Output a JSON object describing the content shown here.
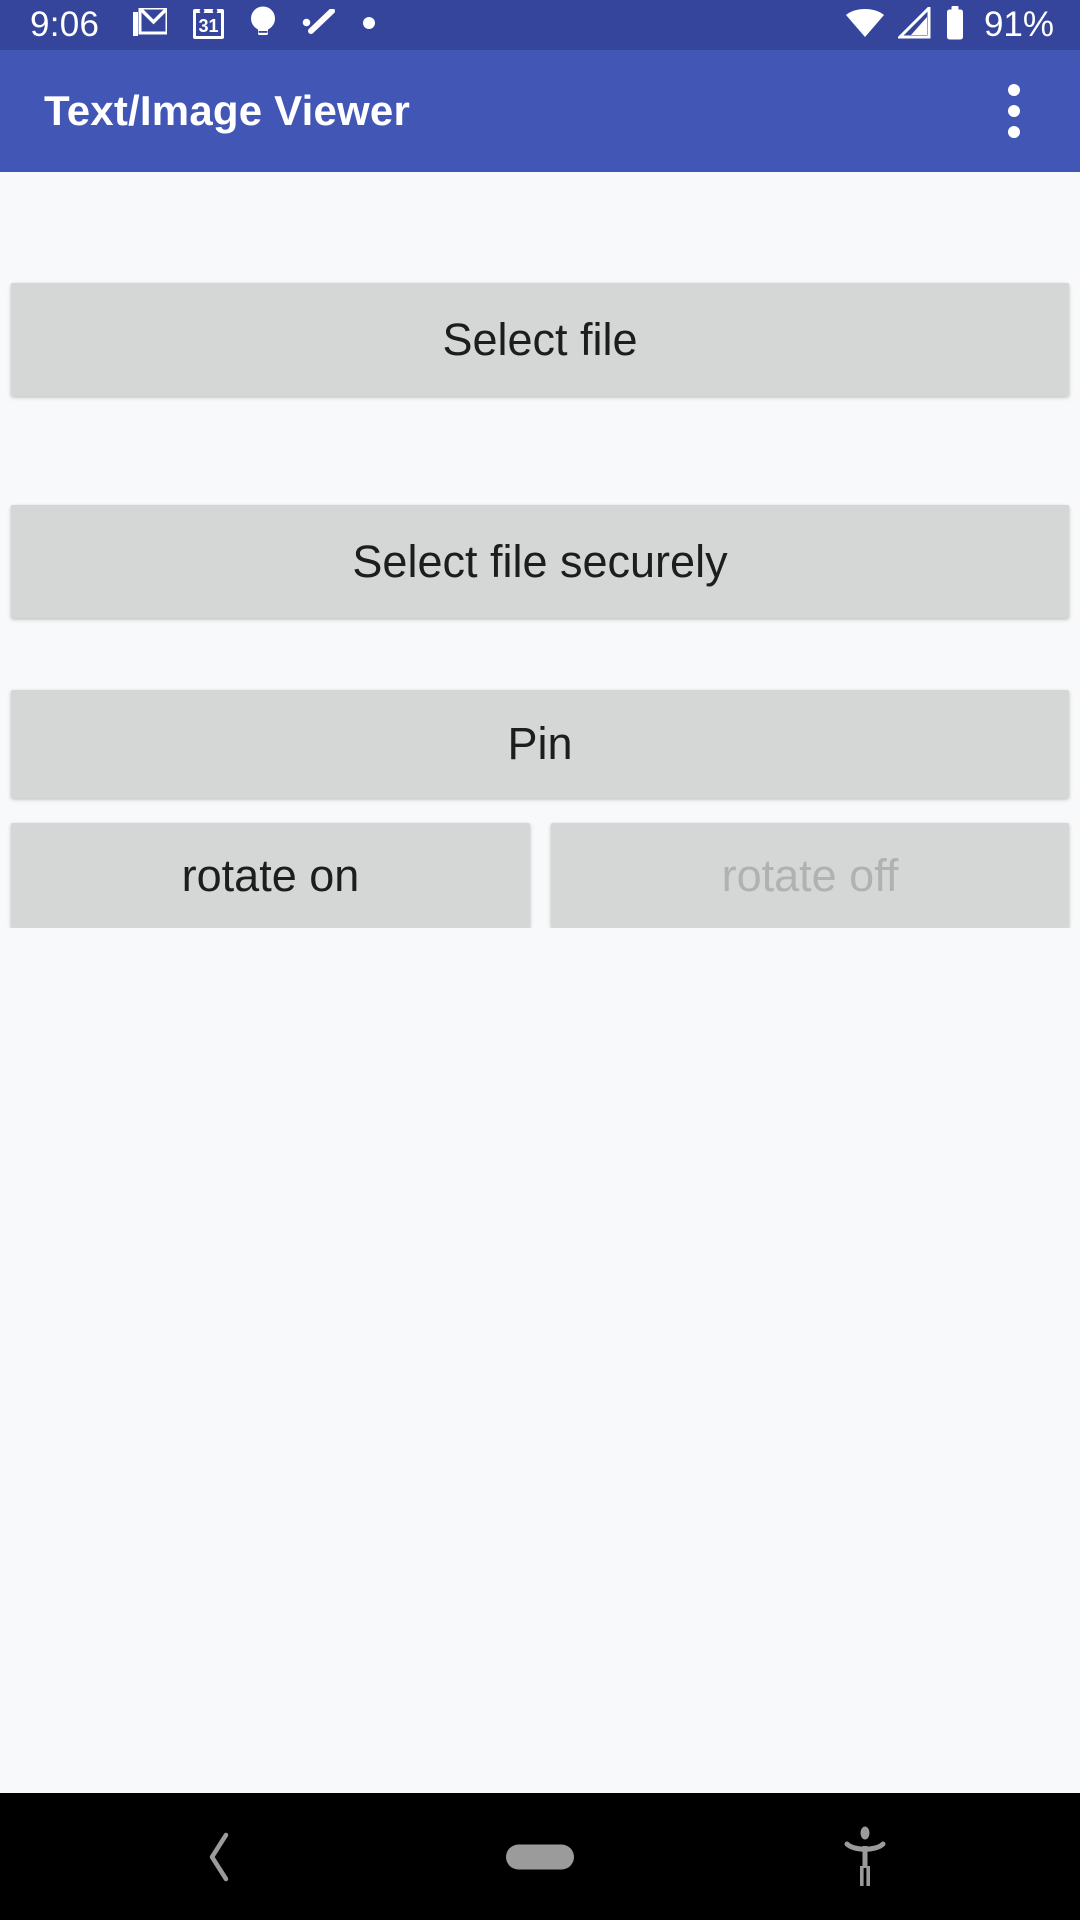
{
  "status_bar": {
    "clock": "9:06",
    "battery_percent": "91%",
    "background_color": "#36459c",
    "foreground_color": "#ffffff",
    "left_icons": [
      {
        "name": "gmail-icon",
        "label": "Gmail"
      },
      {
        "name": "calendar-icon",
        "label": "31"
      },
      {
        "name": "google-keep-icon",
        "label": "Keep"
      },
      {
        "name": "google-tasks-icon",
        "label": "Tasks"
      },
      {
        "name": "more-notifications-dot-icon",
        "label": "More notifications"
      }
    ],
    "right_icons": [
      {
        "name": "wifi-icon",
        "label": "Wi-Fi connected"
      },
      {
        "name": "cell-signal-icon",
        "label": "Mobile signal"
      },
      {
        "name": "battery-icon",
        "label": "Battery"
      }
    ]
  },
  "app_bar": {
    "title": "Text/Image Viewer",
    "background_color": "#4256b5",
    "title_color": "#ffffff",
    "overflow_menu": {
      "name": "overflow-menu-icon",
      "label": "More options"
    }
  },
  "content": {
    "background_color": "#f8f9fa",
    "button_fill": "#d5d7d7",
    "button_text_color": "#1d1d1d",
    "button_disabled_text_color": "#b1b1b1",
    "buttons": [
      {
        "id": "select-file",
        "label": "Select file",
        "enabled": true
      },
      {
        "id": "select-file-securely",
        "label": "Select file securely",
        "enabled": true
      },
      {
        "id": "pin",
        "label": "Pin",
        "enabled": true
      }
    ],
    "rotate_row": [
      {
        "id": "rotate-on",
        "label": "rotate on",
        "enabled": true
      },
      {
        "id": "rotate-off",
        "label": "rotate off",
        "enabled": false
      }
    ],
    "viewer_placeholder": ""
  },
  "nav_bar": {
    "background_color": "#000000",
    "items": [
      {
        "name": "back-icon",
        "label": "Back"
      },
      {
        "name": "home-pill-icon",
        "label": "Home"
      },
      {
        "name": "accessibility-icon",
        "label": "Accessibility"
      }
    ]
  }
}
